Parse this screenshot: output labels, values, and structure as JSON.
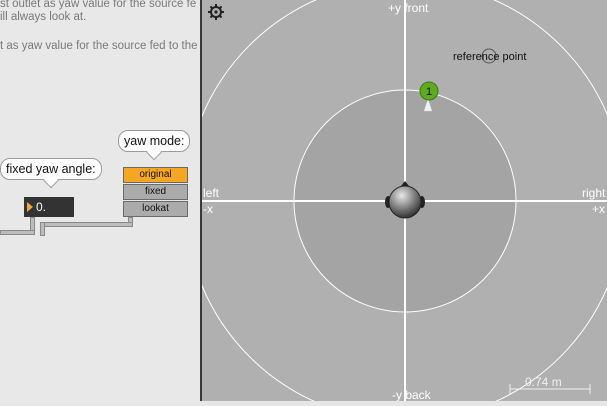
{
  "patcher": {
    "comment_line1": "st outlet as yaw value for the source fe",
    "comment_line2": "ill always look at.",
    "comment_line3": "t as yaw value for the source fed to the",
    "fixed_label": "fixed yaw angle:",
    "number_value": "0.",
    "yaw_mode_label": "yaw mode:",
    "tabs": [
      {
        "label": "original",
        "active": true
      },
      {
        "label": "fixed",
        "active": false
      },
      {
        "label": "lookat",
        "active": false
      }
    ]
  },
  "spat": {
    "top_label": "+y front",
    "bottom_label": "-y back",
    "left_label": "left",
    "left_sub": "-x",
    "right_label": "right",
    "right_sub": "+x",
    "reference_label": "reference point",
    "source_number": "1",
    "scale_label": "0.74 m",
    "colors": {
      "background": "#b0b0b0",
      "inner_circle": "#a4a4a4",
      "grid": "#ffffff",
      "source": "#5faa1f",
      "accent": "#f5a623"
    }
  }
}
